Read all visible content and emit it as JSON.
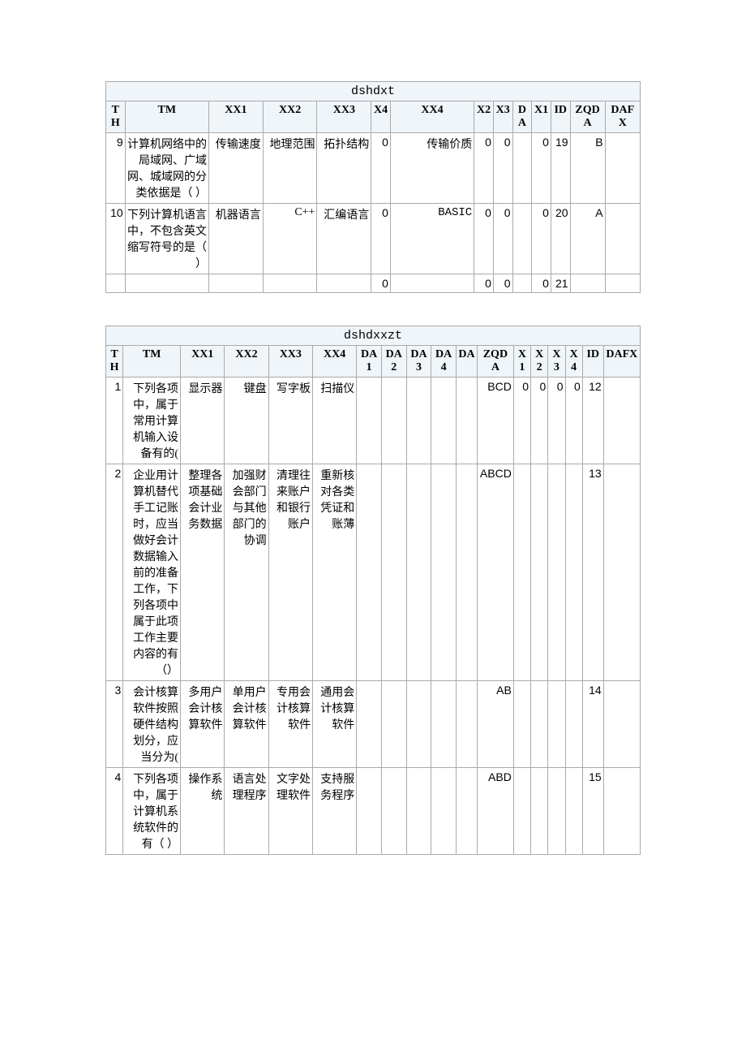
{
  "table1": {
    "title": "dshdxt",
    "headers": [
      "TH",
      "TM",
      "XX1",
      "XX2",
      "XX3",
      "X4",
      "XX4",
      "X2",
      "X3",
      "DA",
      "X1",
      "ID",
      "ZQDA",
      "DAFX"
    ],
    "rows": [
      {
        "th": "9",
        "tm": "计算机网络中的局域网、广域网、城域网的分类依据是（ ）",
        "xx1": "传输速度",
        "xx2": "地理范围",
        "xx3": "拓扑结构",
        "x4": "0",
        "xx4": "传输价质",
        "x2": "0",
        "x3": "0",
        "da": "",
        "x1": "0",
        "id": "19",
        "zqda": "B",
        "dafx": ""
      },
      {
        "th": "10",
        "tm": "下列计算机语言中，不包含英文缩写符号的是（ ）",
        "xx1": "机器语言",
        "xx2": "C++",
        "xx3": "汇编语言",
        "x4": "0",
        "xx4": "BASIC",
        "x2": "0",
        "x3": "0",
        "da": "",
        "x1": "0",
        "id": "20",
        "zqda": "A",
        "dafx": ""
      },
      {
        "th": "",
        "tm": "",
        "xx1": "",
        "xx2": "",
        "xx3": "",
        "x4": "0",
        "xx4": "",
        "x2": "0",
        "x3": "0",
        "da": "",
        "x1": "0",
        "id": "21",
        "zqda": "",
        "dafx": ""
      }
    ]
  },
  "table2": {
    "title": "dshdxxzt",
    "headers": [
      "TH",
      "TM",
      "XX1",
      "XX2",
      "XX3",
      "XX4",
      "DA1",
      "DA2",
      "DA3",
      "DA4",
      "DA",
      "ZQDA",
      "X1",
      "X2",
      "X3",
      "X4",
      "ID",
      "DAFX"
    ],
    "rows": [
      {
        "th": "1",
        "tm": "下列各项中，属于常用计算机输入设备有的(",
        "xx1": "显示器",
        "xx2": "键盘",
        "xx3": "写字板",
        "xx4": "扫描仪",
        "da1": "",
        "da2": "",
        "da3": "",
        "da4": "",
        "da": "",
        "zqda": "BCD",
        "x1": "0",
        "x2": "0",
        "x3": "0",
        "x4": "0",
        "id": "12",
        "dafx": ""
      },
      {
        "th": "2",
        "tm": "企业用计算机替代手工记账时，应当做好会计数据输入前的准备工作，下列各项中属于此项工作主要内容的有（）",
        "xx1": "整理各项基础会计业务数据",
        "xx2": "加强财会部门与其他部门的协调",
        "xx3": "清理往来账户和银行账户",
        "xx4": "重新核对各类凭证和账薄",
        "da1": "",
        "da2": "",
        "da3": "",
        "da4": "",
        "da": "",
        "zqda": "ABCD",
        "x1": "",
        "x2": "",
        "x3": "",
        "x4": "",
        "id": "13",
        "dafx": ""
      },
      {
        "th": "3",
        "tm": "会计核算软件按照硬件结构划分，应当分为(",
        "xx1": "多用户会计核算软件",
        "xx2": "单用户会计核算软件",
        "xx3": "专用会计核算软件",
        "xx4": "通用会计核算软件",
        "da1": "",
        "da2": "",
        "da3": "",
        "da4": "",
        "da": "",
        "zqda": "AB",
        "x1": "",
        "x2": "",
        "x3": "",
        "x4": "",
        "id": "14",
        "dafx": ""
      },
      {
        "th": "4",
        "tm": "下列各项中，属于计算机系统软件的有（ ）",
        "xx1": "操作系统",
        "xx2": "语言处理程序",
        "xx3": "文字处理软件",
        "xx4": "支持服务程序",
        "da1": "",
        "da2": "",
        "da3": "",
        "da4": "",
        "da": "",
        "zqda": "ABD",
        "x1": "",
        "x2": "",
        "x3": "",
        "x4": "",
        "id": "15",
        "dafx": ""
      }
    ]
  }
}
